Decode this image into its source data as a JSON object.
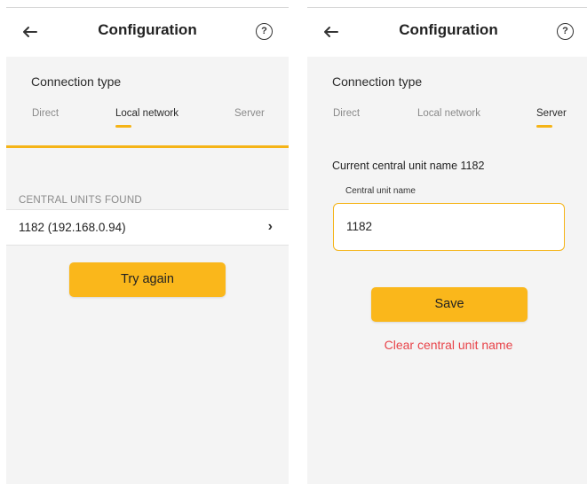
{
  "colors": {
    "accent": "#f5b417",
    "button": "#fab71b",
    "danger": "#e8444a"
  },
  "screens": {
    "left": {
      "header": {
        "title": "Configuration",
        "back_icon": "arrow-left",
        "help_icon": "?"
      },
      "connection_type_label": "Connection type",
      "tabs": [
        "Direct",
        "Local network",
        "Server"
      ],
      "active_tab": "Local network",
      "section_header": "CENTRAL UNITS FOUND",
      "found_units": [
        {
          "label": "1182 (192.168.0.94)",
          "chevron": "›"
        }
      ],
      "try_again_label": "Try again"
    },
    "right": {
      "header": {
        "title": "Configuration",
        "back_icon": "arrow-left",
        "help_icon": "?"
      },
      "connection_type_label": "Connection type",
      "tabs": [
        "Direct",
        "Local network",
        "Server"
      ],
      "active_tab": "Server",
      "current_name_text": "Current central unit name 1182",
      "field_label": "Central unit name",
      "field_value": "1182",
      "save_label": "Save",
      "clear_label": "Clear central unit name"
    }
  }
}
